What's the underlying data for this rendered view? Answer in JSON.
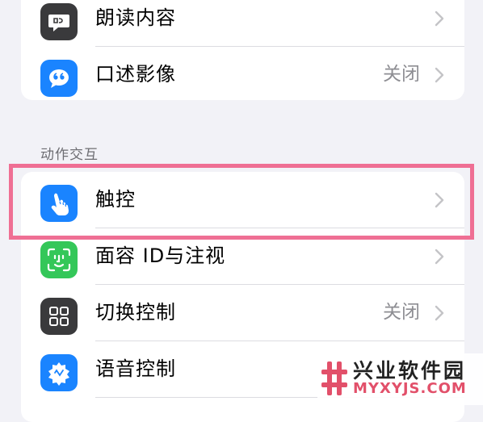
{
  "top_group": {
    "items": [
      {
        "label": "朗读内容",
        "value": "",
        "icon": "speech-bubble-icon",
        "icon_bg": "#3a3a3c"
      },
      {
        "label": "口述影像",
        "value": "关闭",
        "icon": "quote-bubble-icon",
        "icon_bg": "#1a84ff"
      }
    ]
  },
  "interaction_group": {
    "header": "动作交互",
    "items": [
      {
        "label": "触控",
        "value": "",
        "icon": "hand-tap-icon",
        "icon_bg": "#1a84ff"
      },
      {
        "label": "面容 ID与注视",
        "value": "",
        "icon": "face-id-icon",
        "icon_bg": "#34c759"
      },
      {
        "label": "切换控制",
        "value": "关闭",
        "icon": "grid-icon",
        "icon_bg": "#3a3a3c"
      },
      {
        "label": "语音控制",
        "value": "",
        "icon": "voice-control-icon",
        "icon_bg": "#1a84ff"
      }
    ]
  },
  "watermark": {
    "title": "兴业软件园",
    "subtitle": "MYXYJS.COM",
    "accent": "#e2506a"
  },
  "colors": {
    "highlight_border": "#ef6f94",
    "background": "#f2f2f7",
    "secondary_text": "#8e8e93"
  }
}
